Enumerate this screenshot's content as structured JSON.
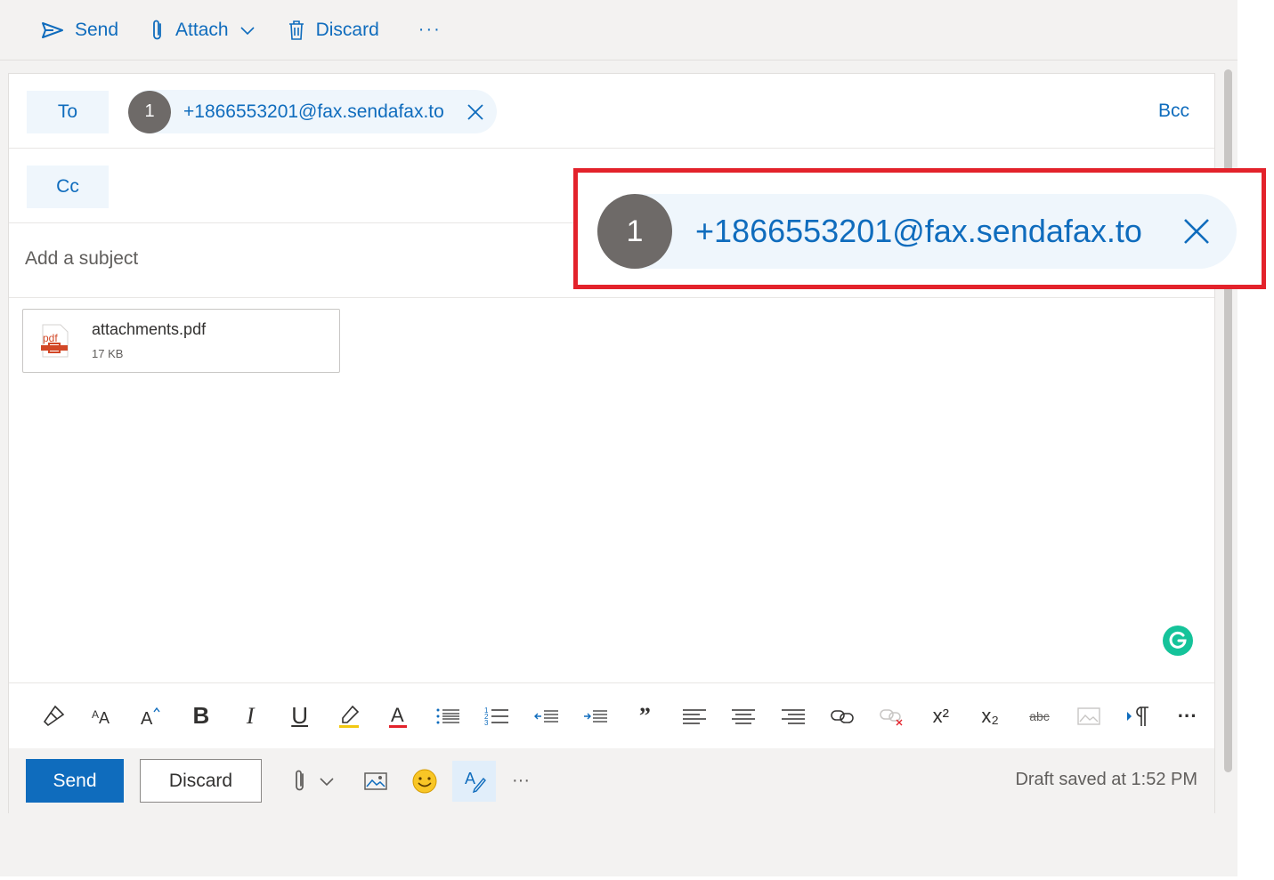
{
  "toolbar": {
    "send_label": "Send",
    "attach_label": "Attach",
    "discard_label": "Discard",
    "more_label": "···"
  },
  "recipients": {
    "to_label": "To",
    "cc_label": "Cc",
    "bcc_label": "Bcc",
    "to": [
      {
        "avatar": "1",
        "email": "+1866553201@fax.sendafax.to"
      }
    ]
  },
  "subject": {
    "placeholder": "Add a subject"
  },
  "attachment": {
    "name": "attachments.pdf",
    "size": "17 KB",
    "icon_label": "pdf"
  },
  "format_toolbar": {
    "items": [
      "format-painter",
      "font-size",
      "grow-font",
      "bold",
      "italic",
      "underline",
      "highlight",
      "font-color",
      "bullets",
      "numbering",
      "decrease-indent",
      "increase-indent",
      "quote",
      "align-left",
      "align-center",
      "align-right",
      "insert-link",
      "remove-link",
      "superscript",
      "subscript",
      "strikethrough",
      "insert-picture-inline",
      "ltr-paragraph",
      "more"
    ],
    "bold": "B",
    "italic": "I",
    "underline": "U",
    "font_color": "A",
    "quote": "”",
    "superscript": "x²",
    "subscript": "x₂",
    "strikethrough": "abc",
    "more": "···"
  },
  "bottom_bar": {
    "send_label": "Send",
    "discard_label": "Discard",
    "more_label": "···",
    "draft_status": "Draft saved at 1:52 PM"
  },
  "callout": {
    "avatar": "1",
    "email": "+1866553201@fax.sendafax.to"
  },
  "colors": {
    "accent": "#0f6cbd",
    "callout_border": "#e3222b",
    "grammarly": "#15c39a",
    "avatar": "#6e6a68"
  }
}
